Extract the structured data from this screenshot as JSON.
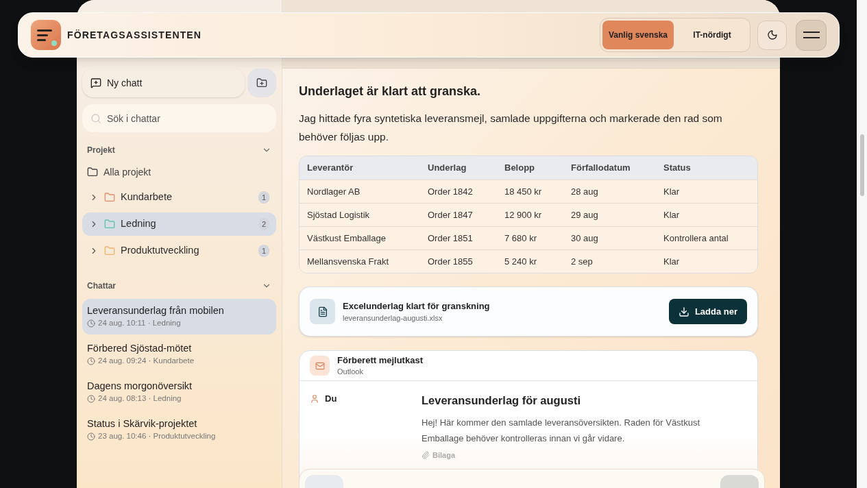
{
  "header": {
    "title": "FÖRETAGSASSISTENTEN",
    "language_options": [
      {
        "label": "Vanlig svenska",
        "selected": true
      },
      {
        "label": "IT-nördigt",
        "selected": false
      }
    ]
  },
  "sidebar": {
    "new_chat": "Ny chatt",
    "search": {
      "placeholder": "Sök i chattar"
    },
    "projects": {
      "title": "Projekt",
      "expanded": true,
      "all_label": "Alla projekt",
      "items": [
        {
          "name": "Kundarbete",
          "count": "1",
          "color": "#e98a6a",
          "expanded": false,
          "selected": false
        },
        {
          "name": "Ledning",
          "count": "2",
          "color": "#5fc4a7",
          "expanded": false,
          "selected": true
        },
        {
          "name": "Produktutveckling",
          "count": "1",
          "color": "#f0b36c",
          "expanded": false,
          "selected": false
        }
      ]
    },
    "chats": {
      "title": "Chattar",
      "expanded": true,
      "items": [
        {
          "title": "Leveransunderlag från mobilen",
          "meta": "24 aug. 10:11 · Ledning",
          "selected": true
        },
        {
          "title": "Förbered Sjöstad-mötet",
          "meta": "24 aug. 09:24 · Kundarbete",
          "selected": false
        },
        {
          "title": "Dagens morgonöversikt",
          "meta": "24 aug. 08:13 · Ledning",
          "selected": false
        },
        {
          "title": "Status i Skärvik-projektet",
          "meta": "23 aug. 10:46 · Produktutveckling",
          "selected": false
        }
      ]
    }
  },
  "message": {
    "heading": "Underlaget är klart att granska.",
    "text": "Jag hittade fyra syntetiska leveransmejl, samlade uppgifterna och markerade den rad som behöver följas upp.",
    "table": {
      "columns": [
        "Leverantör",
        "Underlag",
        "Belopp",
        "Förfallodatum",
        "Status"
      ],
      "rows": [
        [
          "Nordlager AB",
          "Order 1842",
          "18 450 kr",
          "28 aug",
          "Klar"
        ],
        [
          "Sjöstad Logistik",
          "Order 1847",
          "12 900 kr",
          "29 aug",
          "Klar"
        ],
        [
          "Västkust Emballage",
          "Order 1851",
          "7 680 kr",
          "30 aug",
          "Kontrollera antal"
        ],
        [
          "Mellansvenska Frakt",
          "Order 1855",
          "5 240 kr",
          "2 sep",
          "Klar"
        ]
      ]
    },
    "file": {
      "title": "Excelunderlag klart för granskning",
      "filename": "leveransunderlag-augusti.xlsx",
      "button": "Ladda ner"
    },
    "email": {
      "title": "Förberett mejlutkast",
      "app": "Outlook",
      "sender": "Du",
      "subject": "Leveransunderlag för augusti",
      "body": "Hej! Här kommer den samlade leveransöversikten. Raden för Västkust Emballage behöver kontrolleras innan vi går vidare.",
      "attachment": "Bilaga"
    }
  }
}
